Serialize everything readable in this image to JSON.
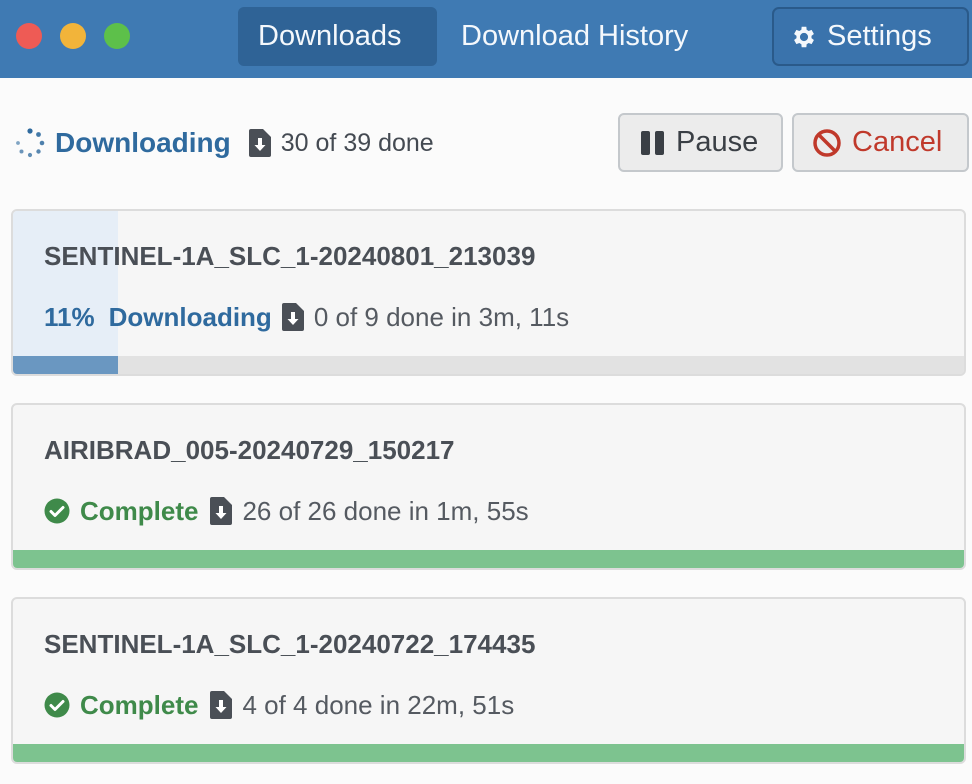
{
  "window": {
    "tabs": [
      {
        "label": "Downloads",
        "active": true
      },
      {
        "label": "Download History",
        "active": false
      }
    ],
    "settings_label": "Settings"
  },
  "overall": {
    "status": "Downloading",
    "count_text": "30 of 39 done",
    "pause_label": "Pause",
    "cancel_label": "Cancel"
  },
  "colors": {
    "accent": "#3f7ab3",
    "downloading": "#2f6a9e",
    "complete": "#3f8a4a",
    "progress_active": "#6a97c1",
    "progress_complete": "#7dc38f",
    "cancel": "#c0392b"
  },
  "downloads": [
    {
      "name": "SENTINEL-1A_SLC_1-20240801_213039",
      "percent": "11%",
      "progress": 0.11,
      "status": "Downloading",
      "detail": "0 of 9 done in 3m, 11s",
      "state": "downloading"
    },
    {
      "name": "AIRIBRAD_005-20240729_150217",
      "progress": 1.0,
      "status": "Complete",
      "detail": "26 of 26 done in 1m, 55s",
      "state": "complete"
    },
    {
      "name": "SENTINEL-1A_SLC_1-20240722_174435",
      "progress": 1.0,
      "status": "Complete",
      "detail": "4 of 4 done in 22m, 51s",
      "state": "complete"
    }
  ]
}
